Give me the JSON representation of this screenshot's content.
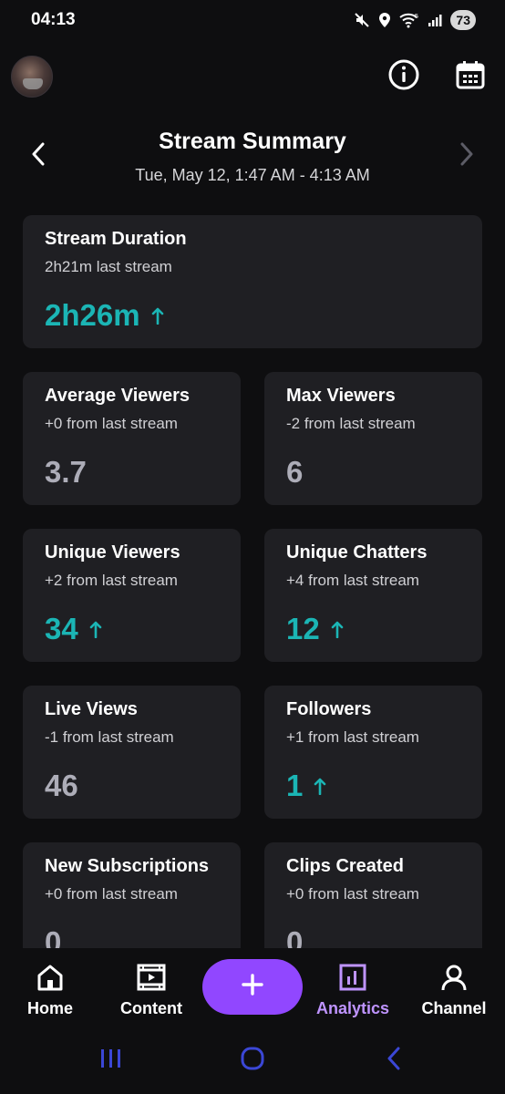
{
  "status_bar": {
    "time": "04:13",
    "battery": "73"
  },
  "header": {
    "title": "Stream Summary",
    "date_range": "Tue, May 12, 1:47 AM - 4:13 AM"
  },
  "cards": [
    {
      "title": "Stream Duration",
      "sub": "2h21m last stream",
      "value": "2h26m",
      "trend": "up"
    },
    {
      "title": "Average Viewers",
      "sub": "+0 from last stream",
      "value": "3.7",
      "trend": "none"
    },
    {
      "title": "Max Viewers",
      "sub": "-2 from last stream",
      "value": "6",
      "trend": "none"
    },
    {
      "title": "Unique Viewers",
      "sub": "+2 from last stream",
      "value": "34",
      "trend": "up"
    },
    {
      "title": "Unique Chatters",
      "sub": "+4 from last stream",
      "value": "12",
      "trend": "up"
    },
    {
      "title": "Live Views",
      "sub": "-1 from last stream",
      "value": "46",
      "trend": "none"
    },
    {
      "title": "Followers",
      "sub": "+1 from last stream",
      "value": "1",
      "trend": "up"
    },
    {
      "title": "New Subscriptions",
      "sub": "+0 from last stream",
      "value": "0",
      "trend": "none"
    },
    {
      "title": "Clips Created",
      "sub": "+0 from last stream",
      "value": "0",
      "trend": "none"
    }
  ],
  "bottom_nav": {
    "items": [
      {
        "label": "Home",
        "icon": "home-icon"
      },
      {
        "label": "Content",
        "icon": "content-icon"
      },
      {
        "label": "Analytics",
        "icon": "analytics-icon",
        "active": true
      },
      {
        "label": "Channel",
        "icon": "channel-icon"
      }
    ],
    "create_icon": "plus-icon"
  },
  "colors": {
    "accent": "#9147ff",
    "active_label": "#bf94ff",
    "trend_up": "#1bb5b5",
    "card_bg": "#1f1f23",
    "background": "#0e0e10"
  }
}
